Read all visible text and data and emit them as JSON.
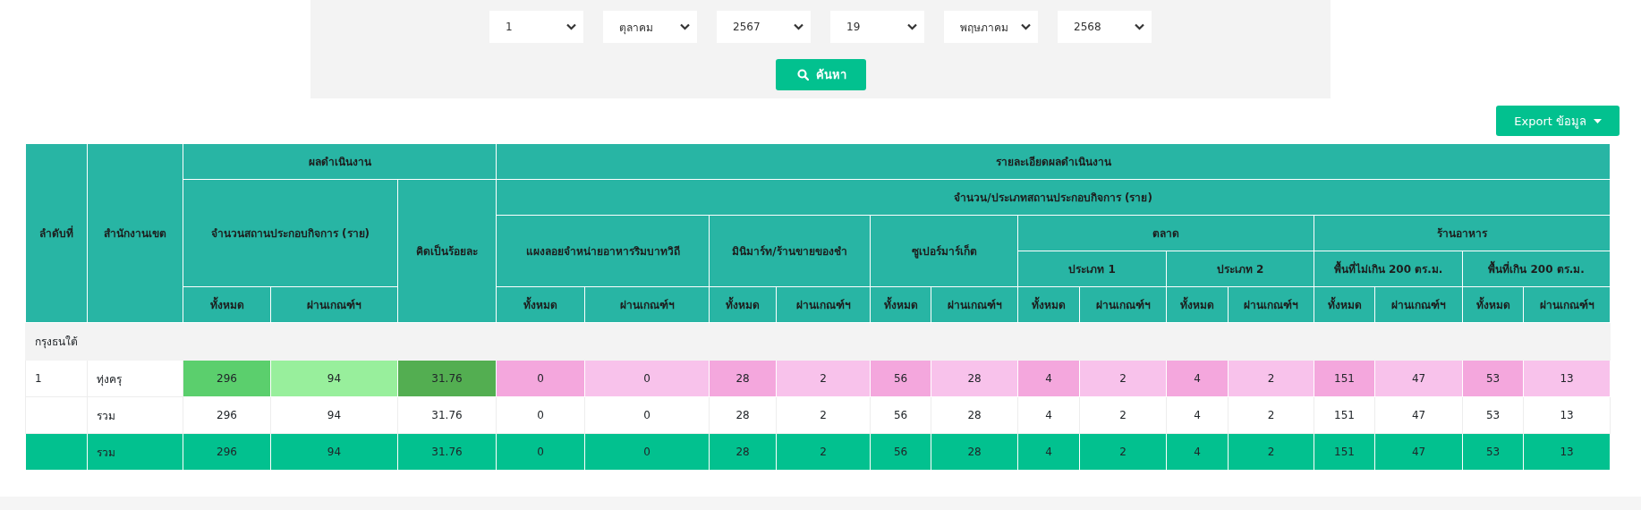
{
  "filters": {
    "selects": [
      {
        "value": "1"
      },
      {
        "value": "ตุลาคม"
      },
      {
        "value": "2567"
      },
      {
        "value": "19"
      },
      {
        "value": "พฤษภาคม"
      },
      {
        "value": "2568"
      }
    ],
    "search_button": {
      "label": "ค้นหา"
    }
  },
  "export_button": {
    "label": "Export ข้อมูล"
  },
  "table": {
    "header": [
      {
        "label": "ลำดับที่"
      },
      {
        "label": "สำนักงานเขต"
      },
      {
        "label": "ผลดำเนินงาน",
        "children": [
          {
            "label": "จำนวนสถานประกอบกิจการ (ราย)",
            "children": [
              {
                "label": "ทั้งหมด"
              },
              {
                "label": "ผ่านเกณฑ์ฯ"
              }
            ]
          },
          {
            "label": "คิดเป็นร้อยละ"
          }
        ]
      },
      {
        "label": "รายละเอียดผลดำเนินงาน",
        "children": [
          {
            "label": "จำนวน/ประเภทสถานประกอบกิจการ (ราย)",
            "children": [
              {
                "label": "แผงลอยจำหน่ายอาหารริมบาทวิถี",
                "children": [
                  {
                    "label": "ทั้งหมด"
                  },
                  {
                    "label": "ผ่านเกณฑ์ฯ"
                  }
                ]
              },
              {
                "label": "มินิมาร์ท/ร้านขายของชำ",
                "children": [
                  {
                    "label": "ทั้งหมด"
                  },
                  {
                    "label": "ผ่านเกณฑ์ฯ"
                  }
                ]
              },
              {
                "label": "ซูเปอร์มาร์เก็ต",
                "children": [
                  {
                    "label": "ทั้งหมด"
                  },
                  {
                    "label": "ผ่านเกณฑ์ฯ"
                  }
                ]
              },
              {
                "label": "ตลาด",
                "children": [
                  {
                    "label": "ประเภท 1",
                    "children": [
                      {
                        "label": "ทั้งหมด"
                      },
                      {
                        "label": "ผ่านเกณฑ์ฯ"
                      }
                    ]
                  },
                  {
                    "label": "ประเภท 2",
                    "children": [
                      {
                        "label": "ทั้งหมด"
                      },
                      {
                        "label": "ผ่านเกณฑ์ฯ"
                      }
                    ]
                  }
                ]
              },
              {
                "label": "ร้านอาหาร",
                "children": [
                  {
                    "label": "พื้นที่ไม่เกิน 200 ตร.ม.",
                    "children": [
                      {
                        "label": "ทั้งหมด"
                      },
                      {
                        "label": "ผ่านเกณฑ์ฯ"
                      }
                    ]
                  },
                  {
                    "label": "พื้นที่เกิน 200 ตร.ม.",
                    "children": [
                      {
                        "label": "ทั้งหมด"
                      },
                      {
                        "label": "ผ่านเกณฑ์ฯ"
                      }
                    ]
                  }
                ]
              }
            ]
          }
        ]
      }
    ],
    "rows": [
      {
        "kind": "group",
        "label": "กรุงธนใต้"
      },
      {
        "kind": "district",
        "number": "1",
        "name": "ทุ่งครุ",
        "cells": [
          {
            "value": "296",
            "color": "#5bcf6d"
          },
          {
            "value": "94",
            "color": "#98ef9c"
          },
          {
            "value": "31.76",
            "color": "#53ae51"
          },
          {
            "value": "0",
            "color": "#f4a7dd"
          },
          {
            "value": "0",
            "color": "#f8c2eb"
          },
          {
            "value": "28",
            "color": "#f4a7dd"
          },
          {
            "value": "2",
            "color": "#f8c2eb"
          },
          {
            "value": "56",
            "color": "#f4a7dd"
          },
          {
            "value": "28",
            "color": "#f8c2eb"
          },
          {
            "value": "4",
            "color": "#f4a7dd"
          },
          {
            "value": "2",
            "color": "#f8c2eb"
          },
          {
            "value": "4",
            "color": "#f4a7dd"
          },
          {
            "value": "2",
            "color": "#f8c2eb"
          },
          {
            "value": "151",
            "color": "#f4a7dd"
          },
          {
            "value": "47",
            "color": "#f8c2eb"
          },
          {
            "value": "53",
            "color": "#f4a7dd"
          },
          {
            "value": "13",
            "color": "#f8c2eb"
          }
        ]
      },
      {
        "kind": "subtotal",
        "name": "รวม",
        "cells": [
          "296",
          "94",
          "31.76",
          "0",
          "0",
          "28",
          "2",
          "56",
          "28",
          "4",
          "2",
          "4",
          "2",
          "151",
          "47",
          "53",
          "13"
        ]
      },
      {
        "kind": "total",
        "name": "รวม",
        "cells": [
          "296",
          "94",
          "31.76",
          "0",
          "0",
          "28",
          "2",
          "56",
          "28",
          "4",
          "2",
          "4",
          "2",
          "151",
          "47",
          "53",
          "13"
        ]
      }
    ]
  }
}
